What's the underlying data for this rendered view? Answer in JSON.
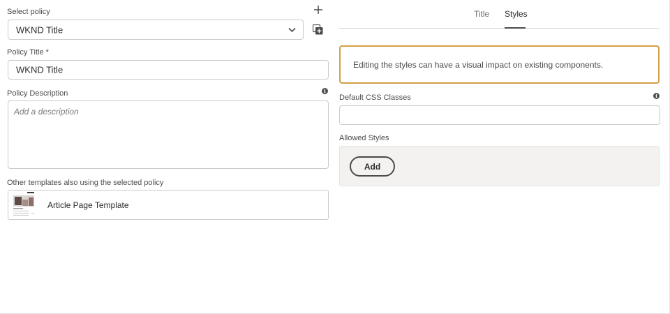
{
  "left": {
    "select_policy_label": "Select policy",
    "selected_policy": "WKND Title",
    "policy_title_label": "Policy Title *",
    "policy_title_value": "WKND Title",
    "policy_description_label": "Policy Description",
    "policy_description_placeholder": "Add a description",
    "other_templates_label": "Other templates also using the selected policy",
    "templates": [
      {
        "name": "Article Page Template"
      }
    ]
  },
  "right": {
    "tabs": [
      {
        "label": "Title",
        "active": false
      },
      {
        "label": "Styles",
        "active": true
      }
    ],
    "warning_text": "Editing the styles can have a visual impact on existing components.",
    "default_css_label": "Default CSS Classes",
    "default_css_value": "",
    "allowed_styles_label": "Allowed Styles",
    "add_button_label": "Add"
  },
  "colors": {
    "warning_border": "#d3a04a",
    "active_tab_underline": "#4b4b4b",
    "styles_panel_bg": "#f3f2f0"
  },
  "icons": {
    "add_policy": "plus-icon",
    "duplicate_policy": "duplicate-icon",
    "dropdown": "chevron-down-icon",
    "info": "info-icon"
  }
}
